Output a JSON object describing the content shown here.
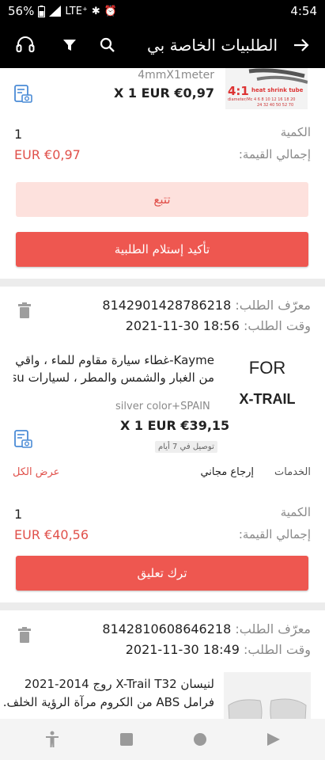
{
  "status_bar": {
    "battery": "56%",
    "network": "LTE⁺",
    "time": "4:54"
  },
  "app_bar": {
    "title": "الطلبيات الخاصة بي"
  },
  "order1": {
    "product_variant": "4mmX1meter",
    "qty_price": "X 1 EUR €0,97",
    "thumb_ratio": "4:1",
    "thumb_caption": "heat shrink tube",
    "thumb_sizes_1": "diameter/Mc  4 6 8 10 12 16 18 20",
    "thumb_sizes_2": "24 32 40 50 52 70",
    "quantity_label": "الكمية",
    "quantity_value": "1",
    "total_label": "إجمالي القيمة:",
    "total_value": "EUR €0,97",
    "track_button": "تتبع",
    "confirm_button": "تأكيد إستلام الطلبية"
  },
  "order2": {
    "order_id_label": "معرّف الطلب:",
    "order_id": "8142901428786218",
    "order_time_label": "وقت الطلب:",
    "order_time": "2021-11-30 18:56",
    "product_title_1": "Kayme-غطاء سيارة مقاوم للماء ، واقي",
    "product_title_2": "من الغبار والشمس والمطر ، لسيارات su...",
    "thumb_line1": "FOR",
    "thumb_line2": "X-TRAIL",
    "product_variant": "silver color+SPAIN",
    "qty_price": "X 1 EUR €39,15",
    "delivery_badge": "توصيل في 7 أيام",
    "services_label": "الخدمات",
    "services_value": "إرجاع مجاني",
    "view_all": "عرض الكل",
    "quantity_label": "الكمية",
    "quantity_value": "1",
    "total_label": "إجمالي القيمة:",
    "total_value": "EUR €40,56",
    "comment_button": "ترك تعليق"
  },
  "order3": {
    "order_id_label": "معرّف الطلب:",
    "order_id": "8142810608646218",
    "order_time_label": "وقت الطلب:",
    "order_time": "2021-11-30 18:49",
    "product_title_1": "لنيسان X-Trail T32 روج 2014-2021",
    "product_title_2": "فرامل ABS من الكروم مرآة الرؤية الخلف."
  }
}
